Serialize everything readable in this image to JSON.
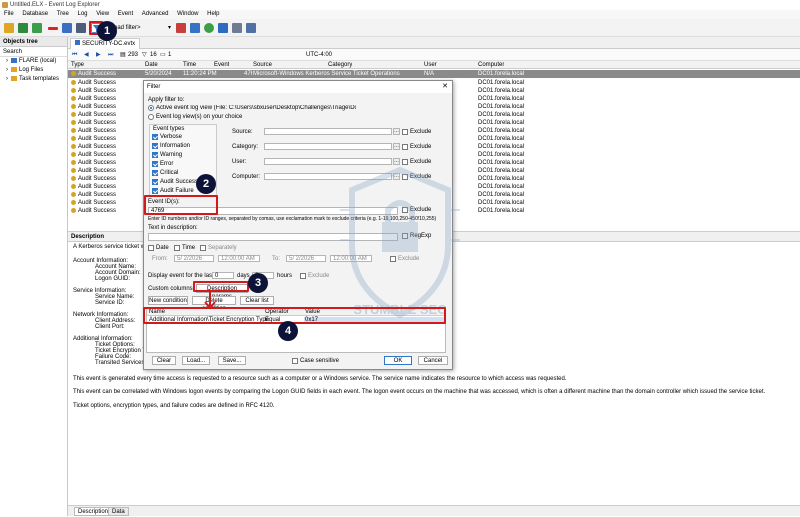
{
  "window": {
    "title": "Untitled.ELX - Event Log Explorer"
  },
  "menu": [
    "File",
    "Database",
    "Tree",
    "Log",
    "View",
    "Event",
    "Advanced",
    "Window",
    "Help"
  ],
  "toolbar": {
    "filter_combo": "oad filter>"
  },
  "objects_tree": {
    "title": "Objects tree",
    "search_label": "Search",
    "items": [
      "FLARE (local)",
      "Log Files",
      "Task templates"
    ]
  },
  "doc_tab": "SECURITY-DC.evtx",
  "nav": {
    "count": "293",
    "filter_count": "16",
    "page": "1",
    "timezone": "UTC-4:00"
  },
  "grid": {
    "columns": [
      "Type",
      "Date",
      "Time",
      "Event",
      "Source",
      "Category",
      "User",
      "Computer"
    ],
    "selected_row": {
      "type": "Audit Success",
      "date": "5/20/2024",
      "time": "11:20:24 PM",
      "event": "4769",
      "source": "Microsoft-Windows Kerberos Service Ticket Operations",
      "category": "Kerberos Service Ticket Operations",
      "user": "N/A",
      "computer": "DC01.forela.local"
    },
    "row_type": "Audit Success",
    "row_computer": "DC01.forela.local"
  },
  "description": {
    "title": "Description",
    "lines": [
      "A Kerberos service ticket wa",
      "Account Information:",
      "Account Name:",
      "Account Domain:",
      "Logon GUID:",
      "Service Information:",
      "Service Name:",
      "Service ID:",
      "Network Information:",
      "Client Address:",
      "Client Port:",
      "Additional Information:",
      "Ticket Options:",
      "Ticket Encryption T",
      "Failure Code:",
      "Transited Services:"
    ],
    "paragraph1": "This event is generated every time access is requested to a resource such as a computer or a Windows service.  The service name indicates the resource to which access was requested.",
    "paragraph2": "This event can be correlated with Windows logon events by comparing the Logon GUID fields in each event.  The logon event occurs on the machine that was accessed, which is often a different machine than the domain controller which issued the service ticket.",
    "paragraph3": "Ticket options, encryption types, and failure codes are defined in RFC 4120."
  },
  "bottom_tabs": [
    "Description",
    "Data"
  ],
  "dialog": {
    "title": "Filter",
    "apply_filter_to": "Apply filter to:",
    "option_active": "Active event log view (File: C:\\Users\\sbxuser\\Desktop\\Challenges\\Triage\\Domain Cont",
    "option_choice": "Event log view(s) on your choice",
    "event_types_label": "Event types",
    "event_types": [
      "Verbose",
      "Information",
      "Warning",
      "Error",
      "Critical",
      "Audit Success",
      "Audit Failure"
    ],
    "source_label": "Source:",
    "category_label": "Category:",
    "user_label": "User:",
    "computer_label": "Computer:",
    "exclude_label": "Exclude",
    "event_ids_label": "Event ID(s):",
    "event_ids_value": "4769",
    "event_ids_hint": "Enter ID numbers and/or ID ranges, separated by comas, use exclamation mark to exclude criteria (e.g. 1-19,100,250-450!10,255)",
    "text_in_description": "Text in description:",
    "regexp_label": "RegExp",
    "date_label": "Date",
    "time_label": "Time",
    "separately_label": "Separately",
    "from_label": "From:",
    "to_label": "To:",
    "from_date": "5/ 2/2026",
    "from_time": "12:00:00 AM",
    "to_date": "5/ 2/2026",
    "to_time": "12:00:00 AM",
    "display_last_label": "Display event for the last",
    "days_value": "0",
    "days_label": "days",
    "hours_value": "0",
    "hours_label": "hours",
    "custom_columns_label": "Custom columns",
    "description_params_button": "Description params",
    "new_condition": "New condition",
    "delete_condition": "Delete condition",
    "clear_list": "Clear list",
    "cond_columns": [
      "Name",
      "Operator",
      "Value"
    ],
    "condition": {
      "name": "Additional Information\\Ticket Encryption Type",
      "operator": "Equal",
      "value": "0x17"
    },
    "clear_button": "Clear",
    "load_button": "Load...",
    "save_button": "Save...",
    "case_sensitive": "Case sensitive",
    "ok_button": "OK",
    "cancel_button": "Cancel"
  },
  "callouts": [
    "1",
    "2",
    "3",
    "4"
  ],
  "watermark_text": "STUMBLE SEC"
}
